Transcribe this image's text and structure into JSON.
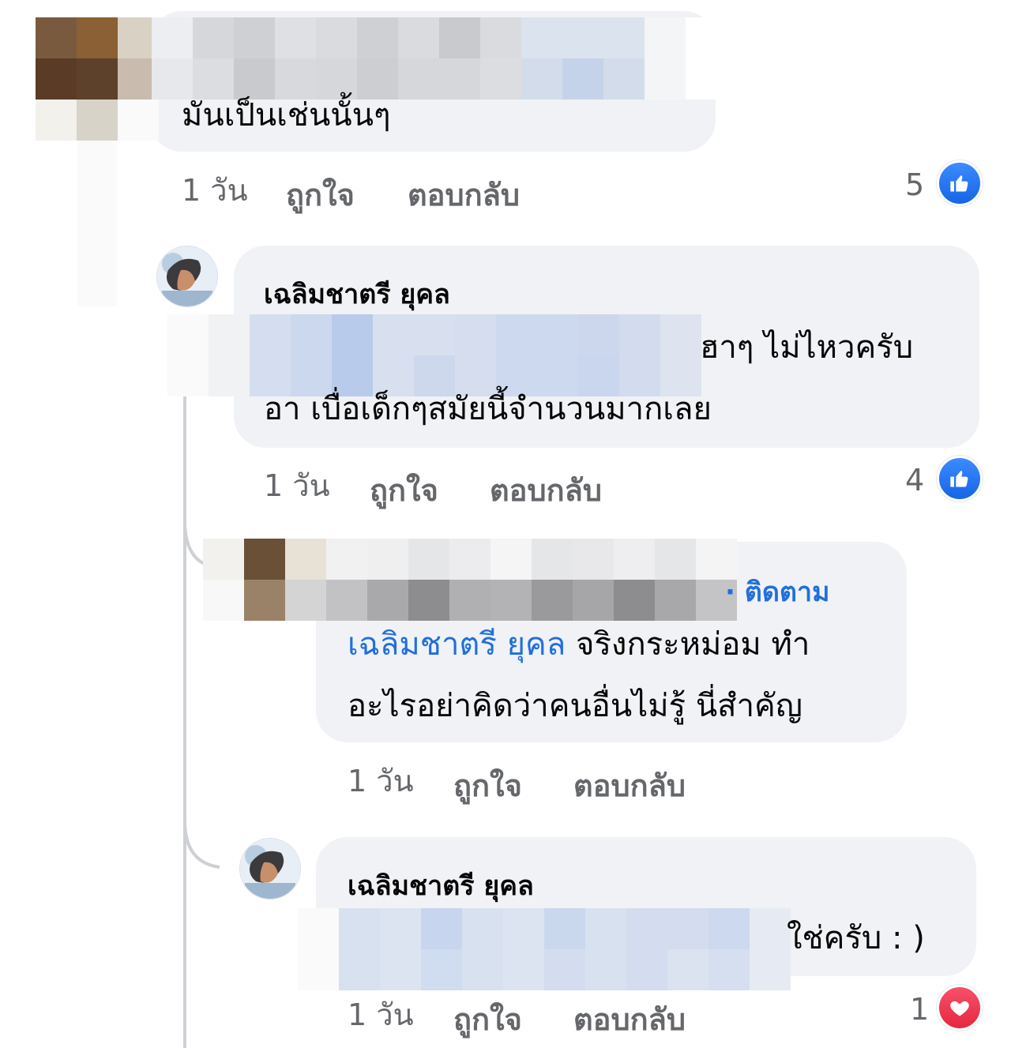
{
  "comments": [
    {
      "text": "มันเป็นเช่นนั้นๆ",
      "time": "1 วัน",
      "like_label": "ถูกใจ",
      "reply_label": "ตอบกลับ",
      "reaction_count": "5",
      "reaction_icon": "thumbs-up-icon"
    },
    {
      "author": "เฉลิมชาตรี ยุคล",
      "text_line1": "ฮาๆ ไม่ไหวครับ",
      "text_line2": "อา เบื่อเด็กๆสมัยนี้จำนวนมากเลย",
      "time": "1 วัน",
      "like_label": "ถูกใจ",
      "reply_label": "ตอบกลับ",
      "reaction_count": "4",
      "reaction_icon": "thumbs-up-icon"
    },
    {
      "follow_label": "· ติดตาม",
      "mention": "เฉลิมชาตรี ยุคล",
      "text_line1": " จริงกระหม่อม ทำ",
      "text_line2": "อะไรอย่าคิดว่าคนอื่นไม่รู้ นี่สำคัญ",
      "time": "1 วัน",
      "like_label": "ถูกใจ",
      "reply_label": "ตอบกลับ"
    },
    {
      "author": "เฉลิมชาตรี ยุคล",
      "text": "ใช่ครับ : )",
      "time": "1 วัน",
      "like_label": "ถูกใจ",
      "reply_label": "ตอบกลับ",
      "reaction_count": "1",
      "reaction_icon": "heart-icon"
    }
  ],
  "colors": {
    "bubble": "#f0f2f5",
    "meta_text": "#65676b",
    "link": "#216fdb",
    "like_blue": "#1877f2",
    "love_red": "#f33e58"
  }
}
